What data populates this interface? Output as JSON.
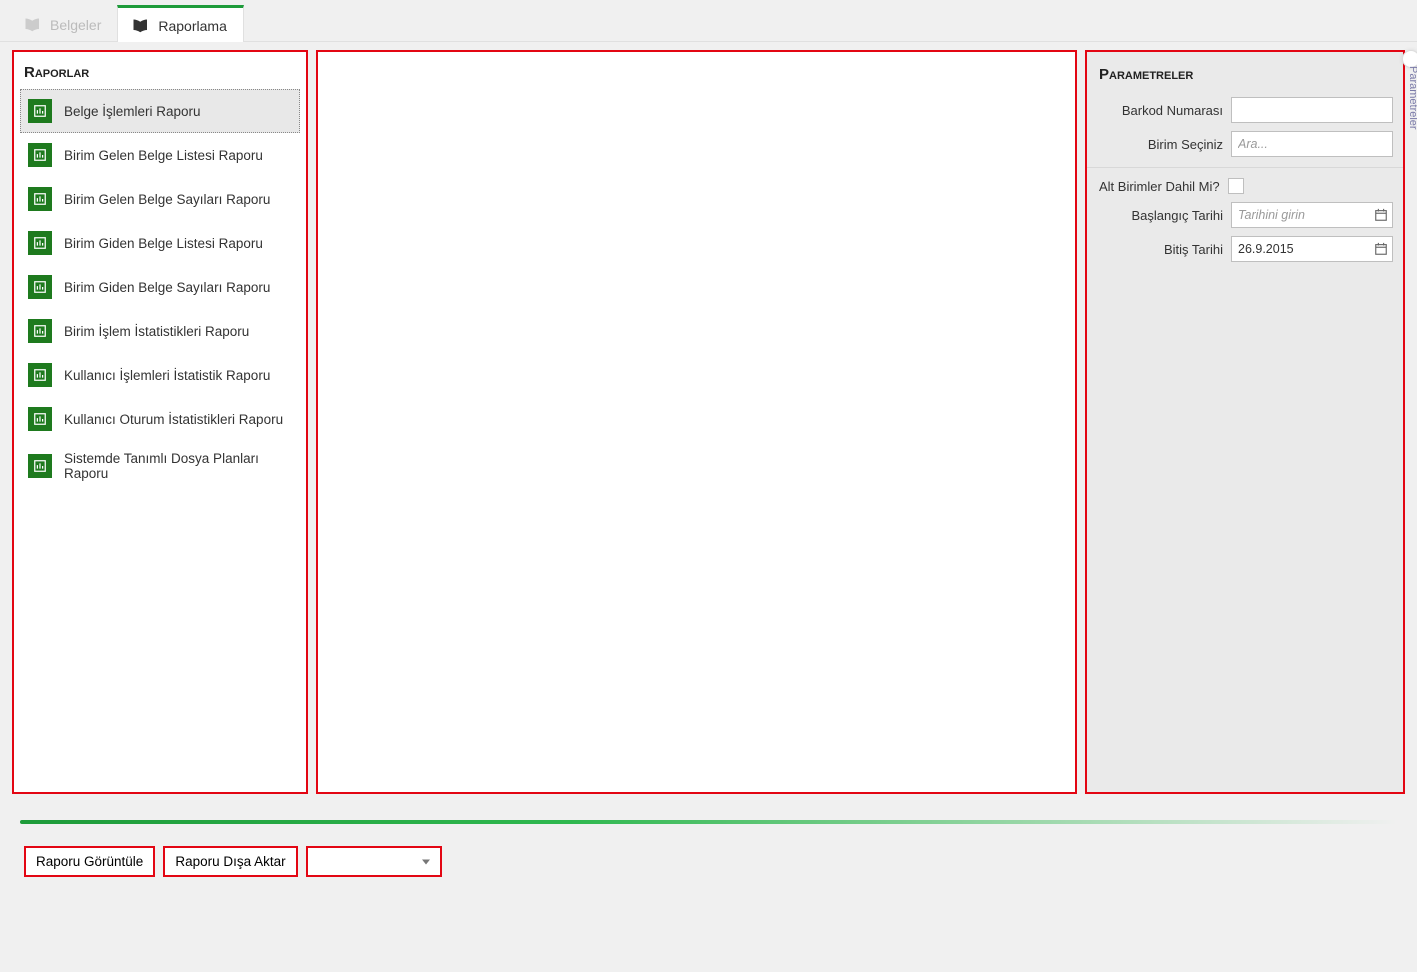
{
  "tabs": {
    "belgeler": "Belgeler",
    "raporlama": "Raporlama"
  },
  "left_panel": {
    "title": "Raporlar",
    "items": [
      "Belge İşlemleri Raporu",
      "Birim Gelen Belge Listesi Raporu",
      "Birim Gelen Belge Sayıları Raporu",
      "Birim Giden Belge Listesi Raporu",
      "Birim Giden Belge Sayıları Raporu",
      "Birim İşlem İstatistikleri Raporu",
      "Kullanıcı İşlemleri İstatistik Raporu",
      "Kullanıcı Oturum İstatistikleri Raporu",
      "Sistemde Tanımlı Dosya Planları Raporu"
    ]
  },
  "right_panel": {
    "title": "Parametreler",
    "barkod_label": "Barkod Numarası",
    "barkod_value": "",
    "birim_label": "Birim Seçiniz",
    "birim_placeholder": "Ara...",
    "birim_value": "",
    "alt_birimler_label": "Alt Birimler Dahil Mi?",
    "alt_birimler_checked": false,
    "baslangic_label": "Başlangıç Tarihi",
    "baslangic_placeholder": "Tarihini girin",
    "baslangic_value": "",
    "bitis_label": "Bitiş Tarihi",
    "bitis_value": "26.9.2015"
  },
  "side_tab": "Parametreler",
  "bottom": {
    "goruntule": "Raporu Görüntüle",
    "disa_aktar": "Raporu Dışa Aktar",
    "select_value": ""
  },
  "icons": {
    "report_icon": "report-icon",
    "book_icon": "book-icon",
    "calendar_icon": "calendar-icon",
    "chevron_down": "chevron-down-icon"
  }
}
